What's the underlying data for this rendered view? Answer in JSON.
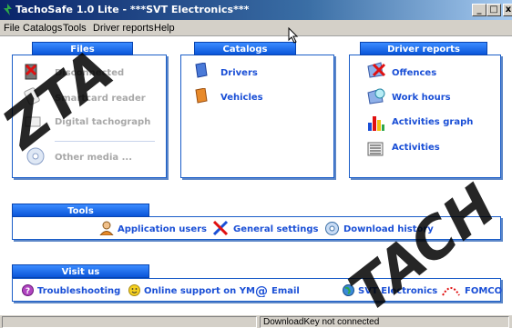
{
  "window": {
    "title": "TachoSafe 1.0 Lite - ***SVT Electronics***",
    "min": "_",
    "max": "□",
    "close": "x"
  },
  "menu": [
    "File",
    "Catalogs",
    "Tools",
    "Driver reports",
    "Help"
  ],
  "files": {
    "header": "Files",
    "items": [
      "Disconnected",
      "Smartcard reader",
      "Digital tachograph",
      "Other media ..."
    ]
  },
  "catalogs": {
    "header": "Catalogs",
    "items": [
      "Drivers",
      "Vehicles"
    ]
  },
  "driver_reports": {
    "header": "Driver reports",
    "items": [
      "Offences",
      "Work hours",
      "Activities graph",
      "Activities"
    ]
  },
  "tools": {
    "header": "Tools",
    "items": [
      "Application users",
      "General settings",
      "Download history"
    ]
  },
  "visit": {
    "header": "Visit us",
    "items": [
      "Troubleshooting",
      "Online support on YM",
      "Email",
      "SVT Electronics",
      "FOMCO"
    ]
  },
  "status": {
    "text": "DownloadKey not connected"
  },
  "colors": {
    "accent": "#1a4fd6",
    "panel_border": "#1a5dc8",
    "titlebar": "#0a246a"
  }
}
